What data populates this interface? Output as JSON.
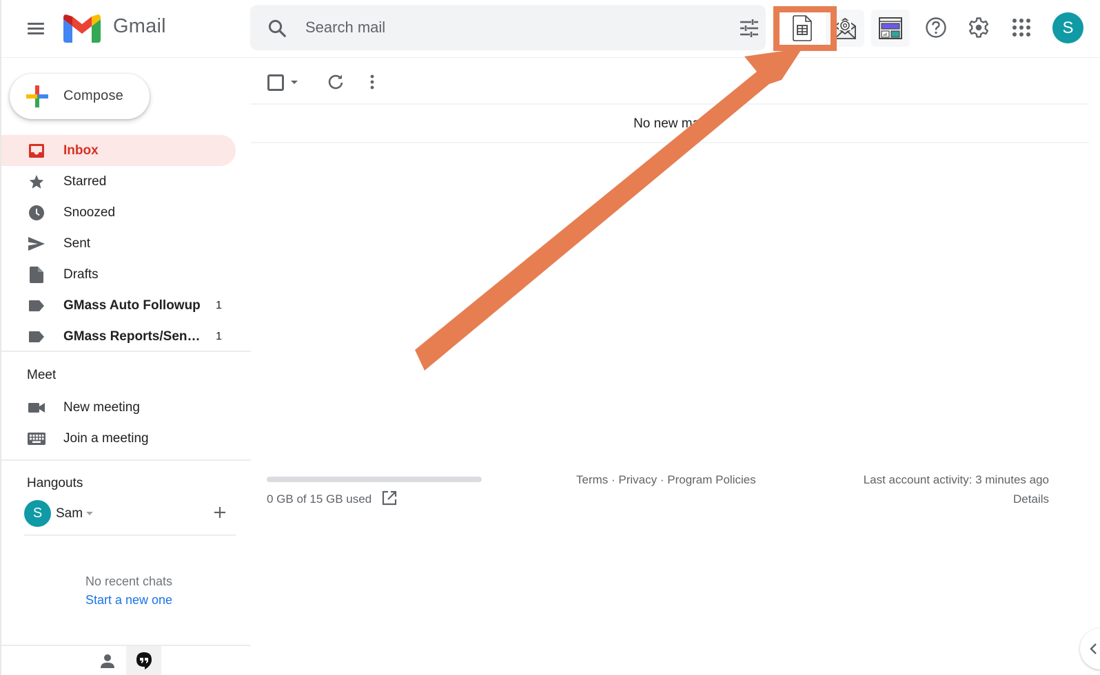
{
  "app": {
    "title": "Gmail",
    "account_initial": "S"
  },
  "search": {
    "placeholder": "Search mail",
    "value": ""
  },
  "header_icons": [
    {
      "name": "sheets-icon",
      "label": "Google Sheets (GMass)",
      "highlighted": true
    },
    {
      "name": "mail-merge-icon",
      "label": "GMass mail"
    },
    {
      "name": "dashboard-icon",
      "label": "GMass dashboard"
    },
    {
      "name": "help-icon",
      "label": "Support"
    },
    {
      "name": "gear-icon",
      "label": "Settings"
    },
    {
      "name": "apps-grid-icon",
      "label": "Google apps"
    }
  ],
  "compose": {
    "label": "Compose"
  },
  "sidebar": {
    "items": [
      {
        "label": "Inbox",
        "icon": "inbox-icon",
        "active": true,
        "count": ""
      },
      {
        "label": "Starred",
        "icon": "star-icon",
        "count": ""
      },
      {
        "label": "Snoozed",
        "icon": "clock-icon",
        "count": ""
      },
      {
        "label": "Sent",
        "icon": "send-icon",
        "count": ""
      },
      {
        "label": "Drafts",
        "icon": "draft-icon",
        "count": ""
      },
      {
        "label": "GMass Auto Followup",
        "icon": "label-icon",
        "bold": true,
        "count": "1"
      },
      {
        "label": "GMass Reports/Sen…",
        "icon": "label-icon",
        "bold": true,
        "count": "1"
      }
    ]
  },
  "meet": {
    "title": "Meet",
    "items": [
      {
        "label": "New meeting",
        "icon": "video-camera-icon"
      },
      {
        "label": "Join a meeting",
        "icon": "keyboard-icon"
      }
    ]
  },
  "hangouts": {
    "title": "Hangouts",
    "user_initial": "S",
    "user_name": "Sam",
    "no_chats": "No recent chats",
    "start_link": "Start a new one"
  },
  "main": {
    "empty_message": "No new mail!",
    "storage_text": "0 GB of 15 GB used",
    "storage_used_fraction": 0.0,
    "footer_links": [
      "Terms",
      "Privacy",
      "Program Policies"
    ],
    "footer_sep": " · ",
    "activity": "Last account activity: 3 minutes ago",
    "details": "Details"
  },
  "annotation": {
    "color": "#e67e51",
    "target": "sheets-icon"
  },
  "colors": {
    "accent_red": "#d93025",
    "inbox_bg": "#fce8e6",
    "avatar": "#0f9aa5",
    "link_blue": "#1a73e8"
  }
}
